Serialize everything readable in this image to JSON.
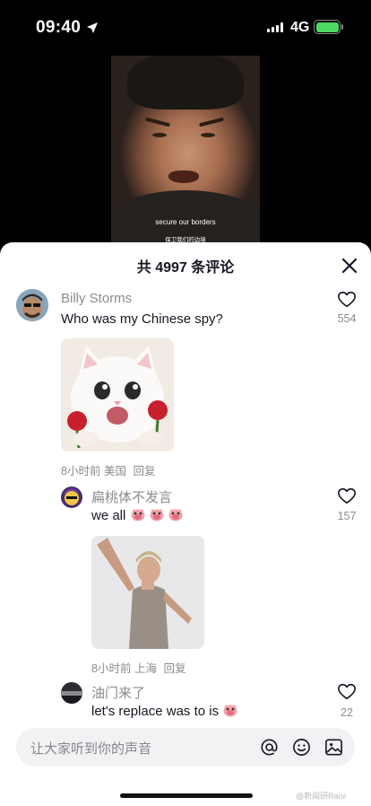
{
  "status_bar": {
    "time": "09:40",
    "network": "4G"
  },
  "video": {
    "subtitle_en": "secure our borders",
    "subtitle_zh": "保卫我们的边境"
  },
  "sheet": {
    "title": "共 4997 条评论"
  },
  "comments": [
    {
      "username": "Billy Storms",
      "text": "Who was my Chinese spy?",
      "time": "8小时前",
      "location": "美国",
      "reply": "回复",
      "likes": "554"
    },
    {
      "username": "扁桃体不发言",
      "text": "we all",
      "time": "8小时前",
      "location": "上海",
      "reply": "回复",
      "likes": "157"
    },
    {
      "username": "油门来了",
      "text": "let's replace was to is",
      "likes": "22"
    }
  ],
  "input": {
    "placeholder": "让大家听到你的声音"
  },
  "watermark": "@新闻研Raisi",
  "colors": {
    "accent_red": "#fe2c55",
    "muted": "#8a8b91",
    "text": "#161823",
    "input_bg": "#f2f2f4",
    "battery": "#4cd964"
  },
  "icons": [
    "location-arrow-icon",
    "close-icon",
    "heart-outline-icon",
    "at-mention-icon",
    "emoji-icon",
    "image-icon",
    "pig-emoji-icon"
  ]
}
